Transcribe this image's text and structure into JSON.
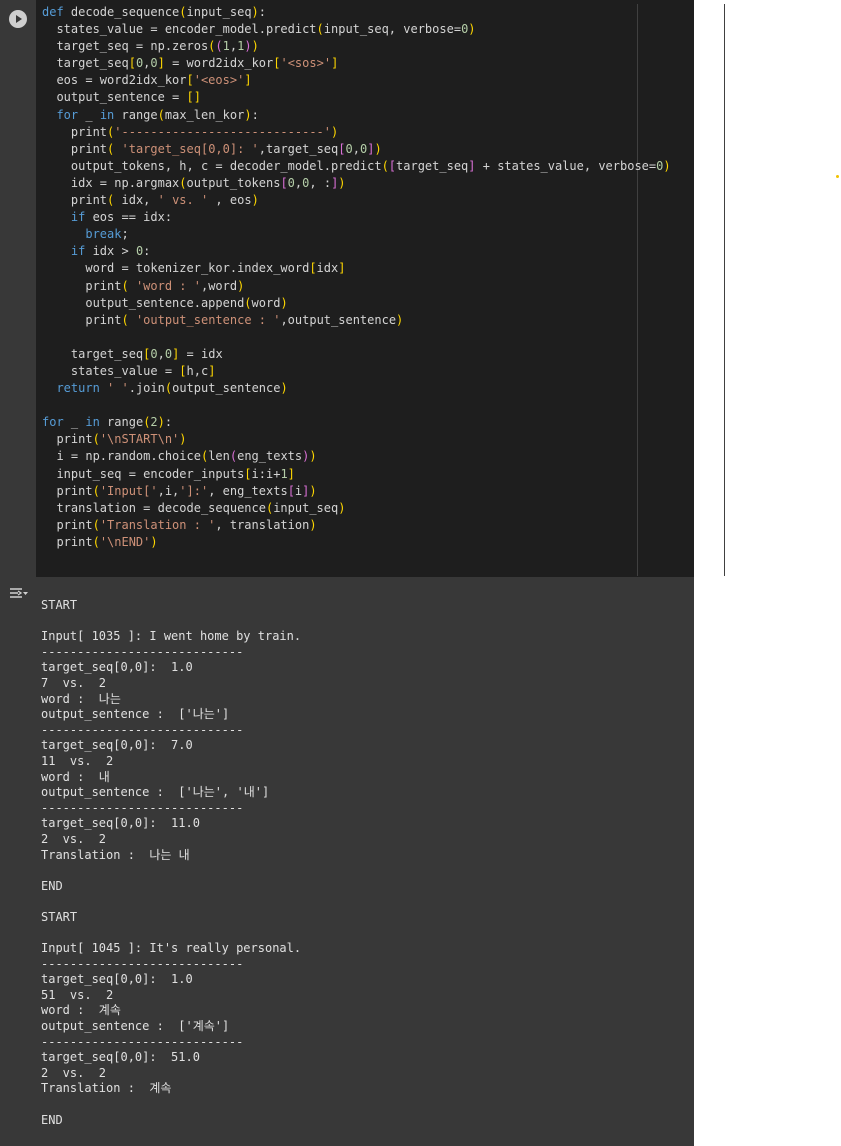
{
  "code": {
    "lines": [
      "def decode_sequence(input_seq):",
      "  states_value = encoder_model.predict(input_seq, verbose=0)",
      "  target_seq = np.zeros((1,1))",
      "  target_seq[0,0] = word2idx_kor['<sos>']",
      "  eos = word2idx_kor['<eos>']",
      "  output_sentence = []",
      "  for _ in range(max_len_kor):",
      "    print('----------------------------')",
      "    print( 'target_seq[0,0]: ',target_seq[0,0])",
      "    output_tokens, h, c = decoder_model.predict([target_seq] + states_value, verbose=0)",
      "    idx = np.argmax(output_tokens[0,0, :])",
      "    print( idx, ' vs. ' , eos)",
      "    if eos == idx:",
      "      break;",
      "    if idx > 0:",
      "      word = tokenizer_kor.index_word[idx]",
      "      print( 'word : ',word)",
      "      output_sentence.append(word)",
      "      print( 'output_sentence : ',output_sentence)",
      "",
      "    target_seq[0,0] = idx",
      "    states_value = [h,c]",
      "  return ' '.join(output_sentence)",
      "",
      "for _ in range(2):",
      "  print('\\nSTART\\n')",
      "  i = np.random.choice(len(eng_texts))",
      "  input_seq = encoder_inputs[i:i+1]",
      "  print('Input[',i,']:', eng_texts[i])",
      "  translation = decode_sequence(input_seq)",
      "  print('Translation : ', translation)",
      "  print('\\nEND')"
    ]
  },
  "output": {
    "lines": [
      "START",
      "",
      "Input[ 1035 ]: I went home by train.",
      "----------------------------",
      "target_seq[0,0]:  1.0",
      "7  vs.  2",
      "word :  나는",
      "output_sentence :  ['나는']",
      "----------------------------",
      "target_seq[0,0]:  7.0",
      "11  vs.  2",
      "word :  내",
      "output_sentence :  ['나는', '내']",
      "----------------------------",
      "target_seq[0,0]:  11.0",
      "2  vs.  2",
      "Translation :  나는 내",
      "",
      "END",
      "",
      "START",
      "",
      "Input[ 1045 ]: It's really personal.",
      "----------------------------",
      "target_seq[0,0]:  1.0",
      "51  vs.  2",
      "word :  계속",
      "output_sentence :  ['계속']",
      "----------------------------",
      "target_seq[0,0]:  51.0",
      "2  vs.  2",
      "Translation :  계속",
      "",
      "END"
    ]
  }
}
